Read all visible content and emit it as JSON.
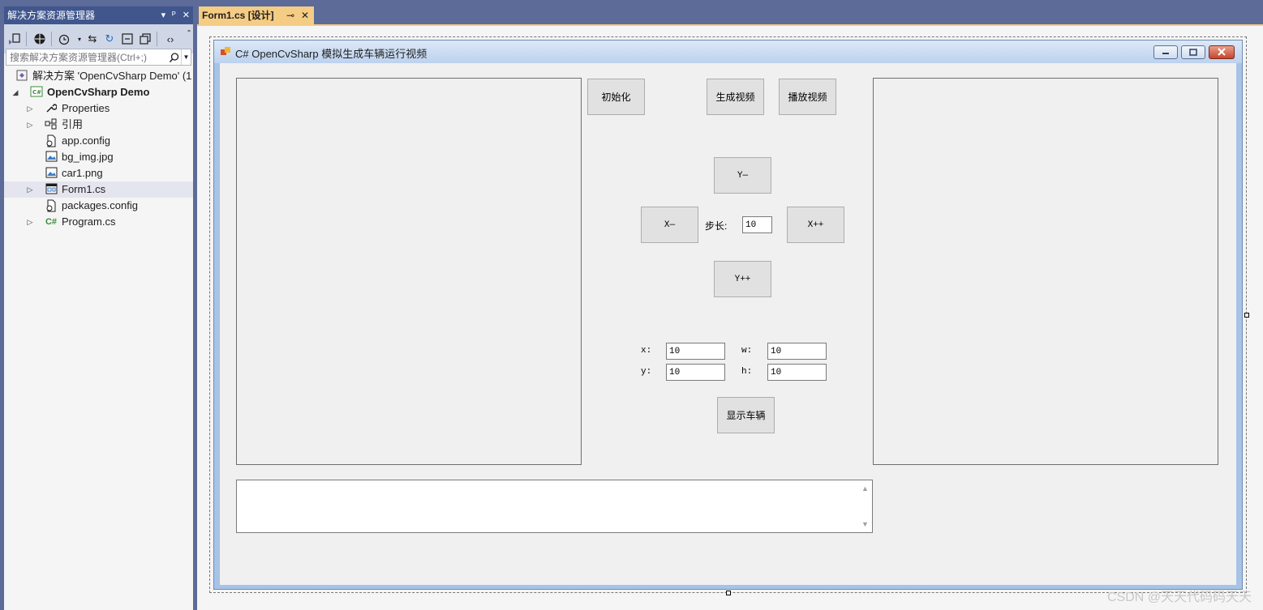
{
  "solution_explorer": {
    "title": "解决方案资源管理器",
    "title_buttons": [
      "▾",
      "ᴾ",
      "✕"
    ],
    "toolbar_icons": [
      "switch-views-icon",
      "globe-icon",
      "history-icon",
      "sync-icon",
      "refresh-icon",
      "collapse-all-icon",
      "copy-icon",
      "code-icon"
    ],
    "search_placeholder": "搜索解决方案资源管理器(Ctrl+;)",
    "tree": [
      {
        "label": "解决方案 'OpenCvSharp Demo' (1",
        "icon": "solution-icon",
        "expander": ""
      },
      {
        "label": "OpenCvSharp Demo",
        "icon": "csharp-project-icon",
        "expander": "◢"
      },
      {
        "label": "Properties",
        "icon": "wrench-icon",
        "expander": "▷"
      },
      {
        "label": "引用",
        "icon": "references-icon",
        "expander": "▷"
      },
      {
        "label": "app.config",
        "icon": "config-file-icon",
        "expander": ""
      },
      {
        "label": "bg_img.jpg",
        "icon": "image-file-icon",
        "expander": ""
      },
      {
        "label": "car1.png",
        "icon": "image-file-icon",
        "expander": ""
      },
      {
        "label": "Form1.cs",
        "icon": "form-icon",
        "expander": "▷"
      },
      {
        "label": "packages.config",
        "icon": "config-file-icon",
        "expander": ""
      },
      {
        "label": "Program.cs",
        "icon": "csharp-file-icon",
        "expander": "▷"
      }
    ]
  },
  "document_tab": {
    "label": "Form1.cs [设计]",
    "pin": "⊸",
    "close": "✕"
  },
  "form": {
    "title": "C# OpenCvSharp 模拟生成车辆运行视频",
    "buttons": {
      "init": "初始化",
      "generate": "生成视频",
      "play": "播放视频",
      "y_minus": "Y—",
      "x_minus": "X—",
      "x_plus": "X++",
      "y_plus": "Y++",
      "show_car": "显示车辆"
    },
    "step_label": "步长:",
    "step_value": "10",
    "fields": {
      "x_label": "x:",
      "x_value": "10",
      "y_label": "y:",
      "y_value": "10",
      "w_label": "w:",
      "w_value": "10",
      "h_label": "h:",
      "h_value": "10"
    }
  },
  "watermark": "CSDN @天天代码码天天"
}
